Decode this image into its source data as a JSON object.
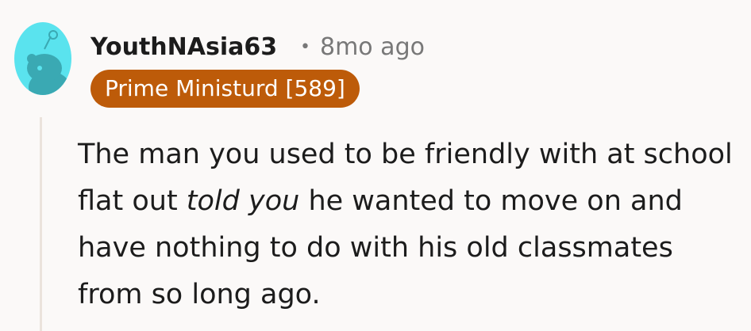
{
  "comment": {
    "author": "YouthNAsia63",
    "separator": "•",
    "timestamp": "8mo ago",
    "flair": "Prime Ministurd [589]",
    "body": {
      "before_emphasis": "The man you used to be friendly with at school flat out ",
      "emphasis": "told you",
      "after_emphasis": " he wanted to move on and have nothing to do with his old classmates from so long ago."
    },
    "avatar_icon": "snoo-avatar-icon"
  },
  "colors": {
    "avatar_bg": "#5ae3ee",
    "flair_bg": "#bd5b09",
    "flair_text": "#ffffff",
    "thread_line": "#ebe3dc",
    "meta_text": "#787878",
    "body_text": "#1c1c1c",
    "page_bg": "#fbf9f8"
  }
}
